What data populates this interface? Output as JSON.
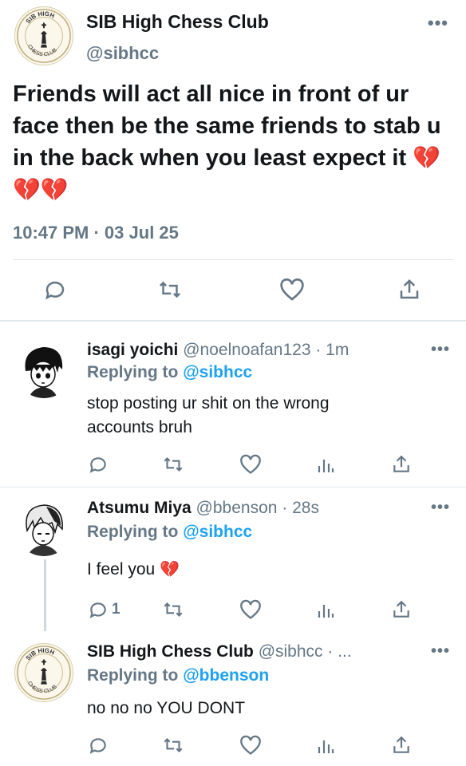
{
  "main_tweet": {
    "name": "SIB High Chess Club",
    "handle": "@sibhcc",
    "avatar_text_top": "SIB HIGH",
    "avatar_text_bottom": "CHESS CLUB",
    "text": "Friends will act all nice in front of ur face then be the same friends to stab u in the back when you least expect it",
    "emoji": "💔💔💔",
    "time": "10:47 PM · 03 Jul 25",
    "more_icon": "more-icon",
    "actions": [
      "reply-icon",
      "retweet-icon",
      "like-icon",
      "share-icon"
    ]
  },
  "replies": [
    {
      "name": "isagi yoichi",
      "handle": "@noelnoafan123 · 1m",
      "replying_prefix": "Replying to",
      "replying_to": "@sibhcc",
      "text_lines": [
        "stop posting ur shit on the wrong",
        "accounts bruh"
      ],
      "reply_count": "",
      "actions": [
        "reply-icon",
        "retweet-icon",
        "like-icon",
        "analytics-icon",
        "share-icon"
      ]
    },
    {
      "name": "Atsumu Miya",
      "handle": "@bbenson · 28s",
      "replying_prefix": "Replying to",
      "replying_to": "@sibhcc",
      "text_lines": [
        "I feel you"
      ],
      "emoji": "💔",
      "reply_count": "1",
      "actions": [
        "reply-icon",
        "retweet-icon",
        "like-icon",
        "analytics-icon",
        "share-icon"
      ]
    },
    {
      "name": "SIB High Chess Club",
      "handle": "@sibhcc · ...",
      "replying_prefix": "Replying to",
      "replying_to": "@bbenson",
      "text_lines": [
        "no no no YOU DONT"
      ],
      "reply_count": "",
      "actions": [
        "reply-icon",
        "retweet-icon",
        "like-icon",
        "analytics-icon",
        "share-icon"
      ]
    }
  ],
  "colors": {
    "text": "#14171a",
    "secondary": "#657786",
    "link": "#1da1f2",
    "heart": "#c8162f",
    "divider": "#e1e8ed"
  }
}
